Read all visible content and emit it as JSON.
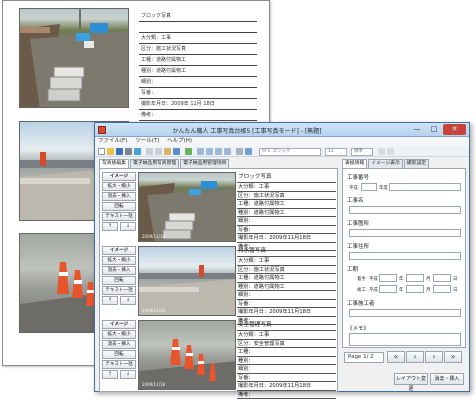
{
  "document": {
    "record1": {
      "rows": [
        "ブロック写真",
        "",
        "大分類：工事",
        "区分：施工状況写真",
        "工種：道路付属物工",
        "種別：道路付属物工",
        "細別：",
        "写番：",
        "撮影年月日：2009年 11月 18日",
        "備考："
      ]
    }
  },
  "window": {
    "title": "かんたん職人 工事写真台帳5 [工事写真モード] - [無題]",
    "min": "—",
    "max": "□",
    "close": "✕"
  },
  "menu": [
    "ファイル(F)",
    "ツール(T)",
    "ヘルプ(H)"
  ],
  "toolbar": {
    "font_combo": "ＭＳ ゴシック",
    "size_combo": "12",
    "color_combo": "標準"
  },
  "left_tabs": [
    "写真帳編集",
    "電子納品用写真管理",
    "電子納品用管理項目"
  ],
  "record_buttons": {
    "ime": "イメージ",
    "zoom": "拡大・縮小",
    "erase": "消去・挿入",
    "rotate": "回転",
    "text": "テキスト一括",
    "up": "↑",
    "down": "↓"
  },
  "records": [
    {
      "date_stamp": "2009/11/18",
      "lines": [
        "ブロック写真",
        "大分類：工事",
        "区分：施工状況写真",
        "工種：道路付属物工",
        "種別：道路付属物工",
        "細別：",
        "写番：",
        "撮影年月日：2009年11月18日",
        "備考："
      ]
    },
    {
      "date_stamp": "2009/11/18",
      "lines": [
        "排水管写真",
        "大分類：工事",
        "区分：施工状況写真",
        "工種：道路付属物工",
        "種別：道路付属物工",
        "細別：",
        "写番：",
        "撮影年月日：2009年11月18日",
        "備考："
      ]
    },
    {
      "date_stamp": "2009/11/18",
      "lines": [
        "安全管理写真",
        "大分類：工事",
        "区分：安全管理写真",
        "工種：",
        "種別：",
        "細別：",
        "写番：",
        "撮影年月日：2009年11月18日",
        "備考："
      ]
    }
  ],
  "right_tabs": [
    "表紙情報",
    "イメージ表示",
    "撮影設定"
  ],
  "cover": {
    "koji_bango": "工事番号",
    "heisei": "平成",
    "nendo": "年度",
    "koji_mei": "工事名",
    "koji_basho": "工事箇所",
    "koji_jusho": "工事住所",
    "koki": "工期",
    "chakko": "着手",
    "kanko": "竣工",
    "heisei2": "平成",
    "nen": "年",
    "tsuki": "月",
    "hi": "日",
    "seko": "工事施工者",
    "memo": "《メモ》"
  },
  "pager": {
    "page": "Page 1/ 2",
    "first": "«",
    "prev": "‹",
    "next": "›",
    "last": "»"
  },
  "bottom_buttons": {
    "layout": "レイアウト変更",
    "erase_insert": "消去・挿入"
  },
  "colors": {
    "title_bar": "#b5d1ee",
    "close_button": "#c8433a",
    "arrow_blue": "#1c4e8c"
  }
}
